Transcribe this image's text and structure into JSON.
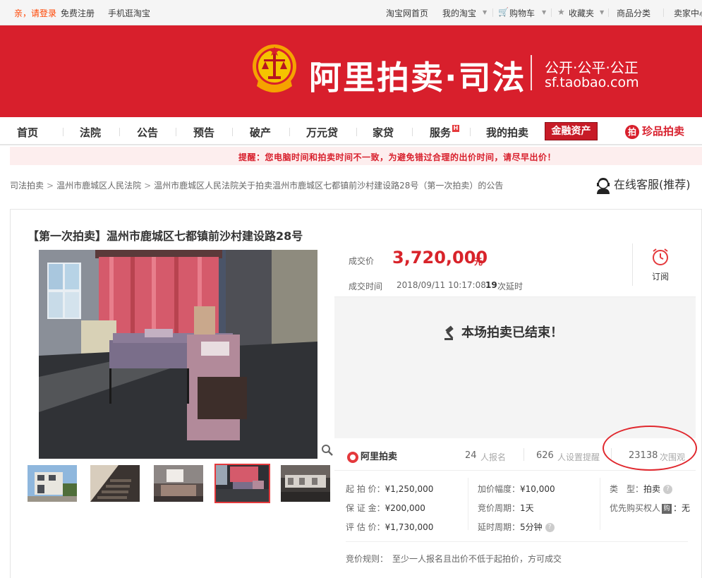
{
  "topbar": {
    "login_prompt": "亲，请登录",
    "register": "免费注册",
    "mobile": "手机逛淘宝",
    "taobao_home": "淘宝网首页",
    "my_taobao": "我的淘宝",
    "cart": "购物车",
    "favorites": "收藏夹",
    "categories": "商品分类",
    "seller_center": "卖家中心"
  },
  "banner": {
    "title": "阿里拍卖·司法",
    "slogan": "公开·公平·公正",
    "url": "sf.taobao.com",
    "bg_color": "#d81f2c"
  },
  "nav": {
    "items": [
      "首页",
      "法院",
      "公告",
      "预告",
      "破产",
      "万元贷",
      "家贷",
      "服务",
      "我的拍卖"
    ],
    "hot_badge": "H",
    "finance": "金融资产",
    "zhenpin": "珍品拍卖",
    "zhenpin_icon": "拍"
  },
  "notice": {
    "text": "提醒：您电脑时间和拍卖时间不一致，为避免错过合理的出价时间，请尽早出价！"
  },
  "breadcrumb": {
    "items": [
      "司法拍卖",
      "温州市鹿城区人民法院",
      "温州市鹿城区人民法院关于拍卖温州市鹿城区七都镇前沙村建设路28号（第一次拍卖）的公告"
    ],
    "separator": ">",
    "service": "在线客服(推荐)"
  },
  "item": {
    "title": "【第一次拍卖】温州市鹿城区七都镇前沙村建设路28号"
  },
  "price": {
    "label": "成交价",
    "value": "3,720,000",
    "unit": "元",
    "time_label": "成交时间",
    "time_value": "2018/09/11 10:17:08",
    "delay_count": "19",
    "delay_label": "次延时",
    "subscribe": "订阅",
    "accent_color": "#d8232a"
  },
  "status": {
    "ended": "本场拍卖已结束！"
  },
  "stats": {
    "logo": "阿里拍卖",
    "signups": "24",
    "signups_label": "人报名",
    "reminders": "626",
    "reminders_label": "人设置提醒",
    "views": "23138",
    "views_label": "次围观"
  },
  "info": {
    "start_price_k": "起 拍 价：",
    "start_price_v": "¥1,250,000",
    "deposit_k": "保 证 金：",
    "deposit_v": "¥200,000",
    "appraisal_k": "评 估 价：",
    "appraisal_v": "¥1,730,000",
    "increment_k": "加价幅度：",
    "increment_v": "¥10,000",
    "period_k": "竞价周期：",
    "period_v": "1天",
    "delay_k": "延时周期：",
    "delay_v": "5分钟",
    "type_k": "类　型：",
    "type_v": "拍卖",
    "priority_k": "优先购买权人",
    "priority_badge": "购",
    "priority_v": "：无",
    "help": "?"
  },
  "rules": {
    "label": "竞价规则：",
    "text": "至少一人报名且出价不低于起拍价，方可成交"
  }
}
